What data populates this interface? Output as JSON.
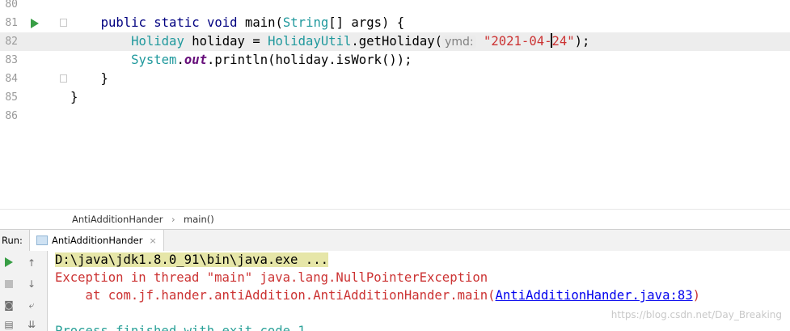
{
  "editor": {
    "lines": [
      {
        "num": "80"
      },
      {
        "num": "81",
        "code": {
          "indent": "    ",
          "kw1": "public static void",
          "name": " main(",
          "type": "String",
          "rest": "[] args) {"
        }
      },
      {
        "num": "82",
        "code": {
          "indent": "        ",
          "cls1": "Holiday",
          "var": " holiday = ",
          "cls2": "HolidayUtil",
          "dot": ".",
          "method": "getHoliday(",
          "hint": "ymd:",
          "str_a": "\"2021-04-",
          "str_b": "24\"",
          "end": ");"
        }
      },
      {
        "num": "83",
        "code": {
          "indent": "        ",
          "cls": "System",
          "dot": ".",
          "field": "out",
          "rest": ".println(holiday.isWork());"
        }
      },
      {
        "num": "84",
        "code": {
          "text": "    }"
        }
      },
      {
        "num": "85",
        "code": {
          "text": "}"
        }
      },
      {
        "num": "86"
      }
    ]
  },
  "breadcrumb": {
    "class_name": "AntiAdditionHander",
    "sep": "›",
    "method": "main()"
  },
  "run_panel": {
    "label": "Run:",
    "tab_label": "AntiAdditionHander",
    "tab_close": "×",
    "toolbar_icons": [
      "run-icon",
      "up-arrow-icon",
      "stop-icon",
      "down-arrow-icon",
      "camera-icon",
      "soft-wrap-icon",
      "layout-icon",
      "scroll-end-icon"
    ]
  },
  "console": {
    "line1": "D:\\java\\jdk1.8.0_91\\bin\\java.exe ...",
    "line2": "Exception in thread \"main\" java.lang.NullPointerException",
    "line3_prefix": "    at com.jf.hander.antiAddition.AntiAdditionHander.main(",
    "line3_link": "AntiAdditionHander.java:83",
    "line3_suffix": ")",
    "line5": "Process finished with exit code 1"
  },
  "watermark": "https://blog.csdn.net/Day_Breaking",
  "colors": {
    "run_green": "#389e45",
    "error_red": "#cc3333",
    "link_blue": "#0000ee",
    "current_line": "#ededed"
  }
}
